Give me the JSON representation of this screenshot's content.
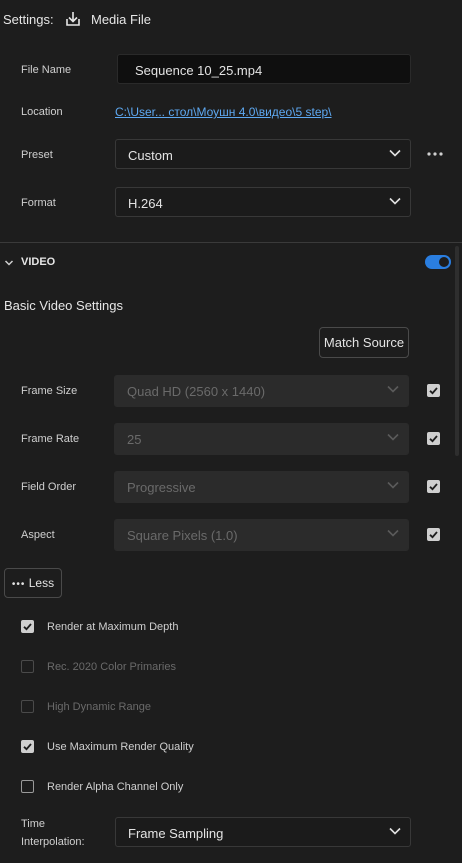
{
  "header": {
    "settings_label": "Settings:",
    "export_icon": "download-icon",
    "target": "Media File"
  },
  "file_name": {
    "label": "File Name",
    "value": "Sequence 10_25.mp4"
  },
  "location": {
    "label": "Location",
    "value": "C:\\User... стол\\Моушн 4.0\\видео\\5 step\\"
  },
  "preset": {
    "label": "Preset",
    "value": "Custom",
    "more_icon": "ellipsis-icon"
  },
  "format": {
    "label": "Format",
    "value": "H.264"
  },
  "video_section": {
    "title": "VIDEO",
    "enabled": true,
    "subheading": "Basic Video Settings",
    "match_source_label": "Match Source",
    "rows": [
      {
        "label": "Frame Size",
        "value": "Quad HD (2560 x 1440)",
        "match_checked": true
      },
      {
        "label": "Frame Rate",
        "value": "25",
        "match_checked": true
      },
      {
        "label": "Field Order",
        "value": "Progressive",
        "match_checked": true
      },
      {
        "label": "Aspect",
        "value": "Square Pixels (1.0)",
        "match_checked": true
      }
    ],
    "less_label": "Less",
    "options": [
      {
        "label": "Render at Maximum Depth",
        "checked": true,
        "enabled": true
      },
      {
        "label": "Rec. 2020 Color Primaries",
        "checked": false,
        "enabled": false
      },
      {
        "label": "High Dynamic Range",
        "checked": false,
        "enabled": false
      },
      {
        "label": "Use Maximum Render Quality",
        "checked": true,
        "enabled": true
      },
      {
        "label": "Render Alpha Channel Only",
        "checked": false,
        "enabled": true
      }
    ],
    "time_interpolation": {
      "label_line1": "Time",
      "label_line2": "Interpolation:",
      "value": "Frame Sampling"
    }
  },
  "colors": {
    "accent": "#2a7ee0",
    "link": "#5ea9f2",
    "background": "#1d1d1d"
  }
}
